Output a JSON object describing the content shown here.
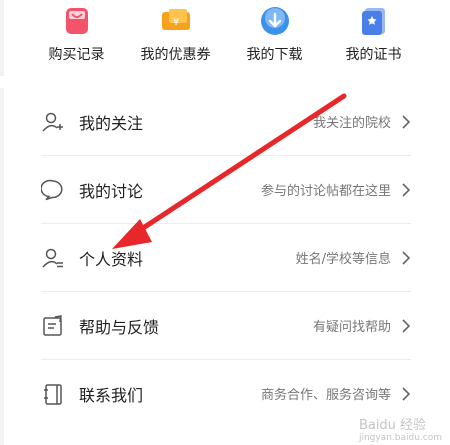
{
  "quick_actions": [
    {
      "label": "购买记录",
      "icon": "shopping-bag-icon",
      "color": "#f4546b"
    },
    {
      "label": "我的优惠券",
      "icon": "coupon-icon",
      "color": "#f7a21c"
    },
    {
      "label": "我的下载",
      "icon": "cloud-download-icon",
      "color": "#3c91e8"
    },
    {
      "label": "我的证书",
      "icon": "certificate-icon",
      "color": "#4a7ee8"
    }
  ],
  "menu": [
    {
      "title": "我的关注",
      "subtitle": "我关注的院校",
      "icon": "user-add-icon"
    },
    {
      "title": "我的讨论",
      "subtitle": "参与的讨论帖都在这里",
      "icon": "chat-bubble-icon"
    },
    {
      "title": "个人资料",
      "subtitle": "姓名/学校等信息",
      "icon": "user-profile-icon"
    },
    {
      "title": "帮助与反馈",
      "subtitle": "有疑问找帮助",
      "icon": "edit-feedback-icon"
    },
    {
      "title": "联系我们",
      "subtitle": "商务合作、服务咨询等",
      "icon": "contact-book-icon"
    }
  ],
  "watermark": {
    "brand": "Baidu 经验",
    "sub": "jingyan.baidu.com"
  },
  "colors": {
    "annotation_arrow": "#e8272a",
    "icon_stroke": "#555555",
    "chevron": "#666666"
  }
}
